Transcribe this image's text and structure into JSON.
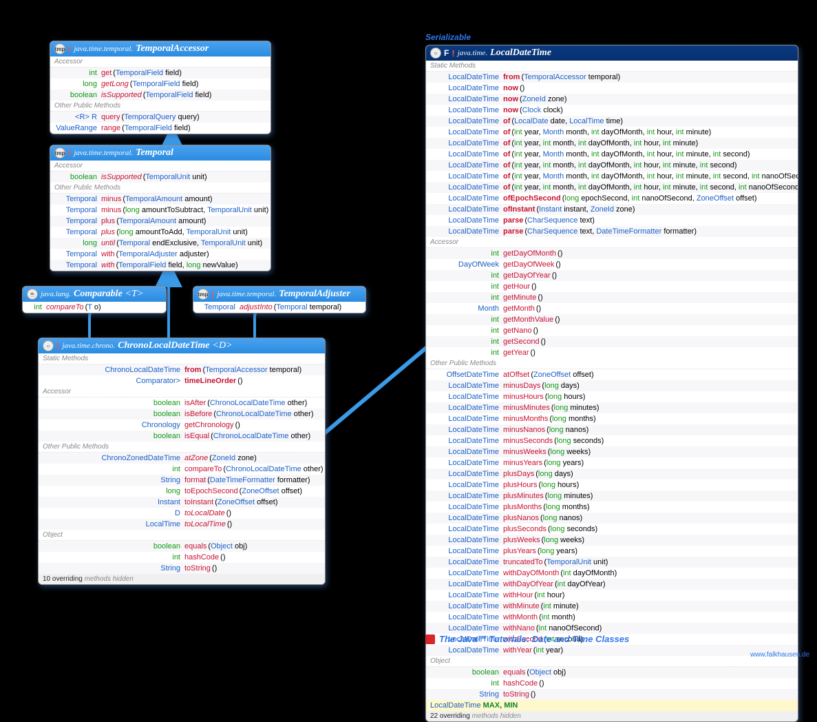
{
  "serializable": "Serializable",
  "tutorial": "The Java™ Tutorials: Date and Time Classes",
  "credit": "www.falkhausen.de",
  "boxes": {
    "ta": {
      "pkg": "java.time.temporal.",
      "name": "TemporalAccessor",
      "iconTxt": "tmp",
      "bang": true,
      "sections": [
        {
          "title": "Accessor",
          "rows": [
            {
              "ret": "int",
              "m": "get",
              "sig": "(TemporalField field)"
            },
            {
              "ret": "long",
              "m": "getLong",
              "sig": "(TemporalField field)",
              "mi": true
            },
            {
              "ret": "boolean",
              "m": "isSupported",
              "sig": "(TemporalField field)",
              "mi": true
            }
          ]
        },
        {
          "title": "Other Public Methods",
          "rows": [
            {
              "ret": "<R> R",
              "m": "query",
              "sig": "(TemporalQuery<R> query)"
            },
            {
              "ret": "ValueRange",
              "m": "range",
              "sig": "(TemporalField field)"
            }
          ]
        }
      ]
    },
    "tp": {
      "pkg": "java.time.temporal.",
      "name": "Temporal",
      "iconTxt": "tmp",
      "bang": true,
      "sections": [
        {
          "title": "Accessor",
          "rows": [
            {
              "ret": "boolean",
              "m": "isSupported",
              "sig": "(TemporalUnit unit)",
              "mi": true
            }
          ]
        },
        {
          "title": "Other Public Methods",
          "rows": [
            {
              "ret": "Temporal",
              "m": "minus",
              "sig": "(TemporalAmount amount)"
            },
            {
              "ret": "Temporal",
              "m": "minus",
              "sig": "(long amountToSubtract, TemporalUnit unit)"
            },
            {
              "ret": "Temporal",
              "m": "plus",
              "sig": "(TemporalAmount amount)"
            },
            {
              "ret": "Temporal",
              "m": "plus",
              "sig": "(long amountToAdd, TemporalUnit unit)",
              "mi": true
            },
            {
              "ret": "long",
              "m": "until",
              "sig": "(Temporal endExclusive, TemporalUnit unit)",
              "mi": true
            },
            {
              "ret": "Temporal",
              "m": "with",
              "sig": "(TemporalAdjuster adjuster)"
            },
            {
              "ret": "Temporal",
              "m": "with",
              "sig": "(TemporalField field, long newValue)",
              "mi": true
            }
          ]
        }
      ]
    },
    "cmp": {
      "pkg": "java.lang.",
      "name": "Comparable",
      "typeParam": "<T>",
      "iconTxt": "☕",
      "bang": false,
      "sections": [
        {
          "title": "",
          "rows": [
            {
              "ret": "int",
              "m": "compareTo",
              "sig": "(T o)",
              "mi": true
            }
          ]
        }
      ]
    },
    "adj": {
      "pkg": "java.time.temporal.",
      "name": "TemporalAdjuster",
      "iconTxt": "tmp",
      "bang": true,
      "sections": [
        {
          "title": "",
          "rows": [
            {
              "ret": "Temporal",
              "m": "adjustInto",
              "sig": "(Temporal temporal)",
              "mi": true
            }
          ]
        }
      ]
    },
    "cldt": {
      "pkg": "java.time.chrono.",
      "name": "ChronoLocalDateTime",
      "typeParam": "<D>",
      "iconTxt": "○",
      "bang": true,
      "sections": [
        {
          "title": "Static Methods",
          "rows": [
            {
              "ret": "ChronoLocalDateTime<?>",
              "m": "from",
              "sig": "(TemporalAccessor temporal)",
              "mb": true
            },
            {
              "ret": "Comparator<ChronoLocalDateTime<?>>",
              "m": "timeLineOrder",
              "sig": "()",
              "mb": true
            }
          ]
        },
        {
          "title": "Accessor",
          "rows": [
            {
              "ret": "boolean",
              "m": "isAfter",
              "sig": "(ChronoLocalDateTime<?> other)"
            },
            {
              "ret": "boolean",
              "m": "isBefore",
              "sig": "(ChronoLocalDateTime<?> other)"
            },
            {
              "ret": "Chronology",
              "m": "getChronology",
              "sig": "()"
            },
            {
              "ret": "boolean",
              "m": "isEqual",
              "sig": "(ChronoLocalDateTime<?> other)"
            }
          ]
        },
        {
          "title": "Other Public Methods",
          "rows": [
            {
              "ret": "ChronoZonedDateTime<D>",
              "m": "atZone",
              "sig": "(ZoneId zone)",
              "mi": true
            },
            {
              "ret": "int",
              "m": "compareTo",
              "sig": "(ChronoLocalDateTime<?> other)"
            },
            {
              "ret": "String",
              "m": "format",
              "sig": "(DateTimeFormatter formatter)"
            },
            {
              "ret": "long",
              "m": "toEpochSecond",
              "sig": "(ZoneOffset offset)"
            },
            {
              "ret": "Instant",
              "m": "toInstant",
              "sig": "(ZoneOffset offset)"
            },
            {
              "ret": "D",
              "m": "toLocalDate",
              "sig": "()",
              "mi": true
            },
            {
              "ret": "LocalTime",
              "m": "toLocalTime",
              "sig": "()",
              "mi": true
            }
          ]
        },
        {
          "title": "Object",
          "rows": [
            {
              "ret": "boolean",
              "m": "equals",
              "sig": "(Object obj)"
            },
            {
              "ret": "int",
              "m": "hashCode",
              "sig": "()"
            },
            {
              "ret": "String",
              "m": "toString",
              "sig": "()"
            }
          ]
        }
      ],
      "hidden": "10 overriding"
    },
    "ldt": {
      "pkg": "java.time.",
      "name": "LocalDateTime",
      "iconTxt": "○",
      "bang": true,
      "finalBar": true,
      "sections": [
        {
          "title": "Static Methods",
          "rows": [
            {
              "ret": "LocalDateTime",
              "m": "from",
              "sig": "(TemporalAccessor temporal)",
              "mb": true
            },
            {
              "ret": "LocalDateTime",
              "m": "now",
              "sig": "()",
              "mb": true
            },
            {
              "ret": "LocalDateTime",
              "m": "now",
              "sig": "(ZoneId zone)",
              "mb": true
            },
            {
              "ret": "LocalDateTime",
              "m": "now",
              "sig": "(Clock clock)",
              "mb": true
            },
            {
              "ret": "LocalDateTime",
              "m": "of",
              "sig": "(LocalDate date, LocalTime time)",
              "mb": true
            },
            {
              "ret": "LocalDateTime",
              "m": "of",
              "sig": "(int year, Month month, int dayOfMonth, int hour, int minute)",
              "mb": true
            },
            {
              "ret": "LocalDateTime",
              "m": "of",
              "sig": "(int year, int month, int dayOfMonth, int hour, int minute)",
              "mb": true
            },
            {
              "ret": "LocalDateTime",
              "m": "of",
              "sig": "(int year, Month month, int dayOfMonth, int hour, int minute, int second)",
              "mb": true
            },
            {
              "ret": "LocalDateTime",
              "m": "of",
              "sig": "(int year, int month, int dayOfMonth, int hour, int minute, int second)",
              "mb": true
            },
            {
              "ret": "LocalDateTime",
              "m": "of",
              "sig": "(int year, Month month, int dayOfMonth, int hour, int minute, int second, int nanoOfSecond)",
              "mb": true
            },
            {
              "ret": "LocalDateTime",
              "m": "of",
              "sig": "(int year, int month, int dayOfMonth, int hour, int minute, int second, int nanoOfSecond)",
              "mb": true
            },
            {
              "ret": "LocalDateTime",
              "m": "ofEpochSecond",
              "sig": "(long epochSecond, int nanoOfSecond, ZoneOffset offset)",
              "mb": true
            },
            {
              "ret": "LocalDateTime",
              "m": "ofInstant",
              "sig": "(Instant instant, ZoneId zone)",
              "mb": true
            },
            {
              "ret": "LocalDateTime",
              "m": "parse",
              "sig": "(CharSequence text)",
              "mb": true
            },
            {
              "ret": "LocalDateTime",
              "m": "parse",
              "sig": "(CharSequence text, DateTimeFormatter formatter)",
              "mb": true
            }
          ]
        },
        {
          "title": "Accessor",
          "rows": [
            {
              "ret": "int",
              "m": "getDayOfMonth",
              "sig": "()"
            },
            {
              "ret": "DayOfWeek",
              "m": "getDayOfWeek",
              "sig": "()"
            },
            {
              "ret": "int",
              "m": "getDayOfYear",
              "sig": "()"
            },
            {
              "ret": "int",
              "m": "getHour",
              "sig": "()"
            },
            {
              "ret": "int",
              "m": "getMinute",
              "sig": "()"
            },
            {
              "ret": "Month",
              "m": "getMonth",
              "sig": "()"
            },
            {
              "ret": "int",
              "m": "getMonthValue",
              "sig": "()"
            },
            {
              "ret": "int",
              "m": "getNano",
              "sig": "()"
            },
            {
              "ret": "int",
              "m": "getSecond",
              "sig": "()"
            },
            {
              "ret": "int",
              "m": "getYear",
              "sig": "()"
            }
          ]
        },
        {
          "title": "Other Public Methods",
          "rows": [
            {
              "ret": "OffsetDateTime",
              "m": "atOffset",
              "sig": "(ZoneOffset offset)"
            },
            {
              "ret": "LocalDateTime",
              "m": "minusDays",
              "sig": "(long days)"
            },
            {
              "ret": "LocalDateTime",
              "m": "minusHours",
              "sig": "(long hours)"
            },
            {
              "ret": "LocalDateTime",
              "m": "minusMinutes",
              "sig": "(long minutes)"
            },
            {
              "ret": "LocalDateTime",
              "m": "minusMonths",
              "sig": "(long months)"
            },
            {
              "ret": "LocalDateTime",
              "m": "minusNanos",
              "sig": "(long nanos)"
            },
            {
              "ret": "LocalDateTime",
              "m": "minusSeconds",
              "sig": "(long seconds)"
            },
            {
              "ret": "LocalDateTime",
              "m": "minusWeeks",
              "sig": "(long weeks)"
            },
            {
              "ret": "LocalDateTime",
              "m": "minusYears",
              "sig": "(long years)"
            },
            {
              "ret": "LocalDateTime",
              "m": "plusDays",
              "sig": "(long days)"
            },
            {
              "ret": "LocalDateTime",
              "m": "plusHours",
              "sig": "(long hours)"
            },
            {
              "ret": "LocalDateTime",
              "m": "plusMinutes",
              "sig": "(long minutes)"
            },
            {
              "ret": "LocalDateTime",
              "m": "plusMonths",
              "sig": "(long months)"
            },
            {
              "ret": "LocalDateTime",
              "m": "plusNanos",
              "sig": "(long nanos)"
            },
            {
              "ret": "LocalDateTime",
              "m": "plusSeconds",
              "sig": "(long seconds)"
            },
            {
              "ret": "LocalDateTime",
              "m": "plusWeeks",
              "sig": "(long weeks)"
            },
            {
              "ret": "LocalDateTime",
              "m": "plusYears",
              "sig": "(long years)"
            },
            {
              "ret": "LocalDateTime",
              "m": "truncatedTo",
              "sig": "(TemporalUnit unit)"
            },
            {
              "ret": "LocalDateTime",
              "m": "withDayOfMonth",
              "sig": "(int dayOfMonth)"
            },
            {
              "ret": "LocalDateTime",
              "m": "withDayOfYear",
              "sig": "(int dayOfYear)"
            },
            {
              "ret": "LocalDateTime",
              "m": "withHour",
              "sig": "(int hour)"
            },
            {
              "ret": "LocalDateTime",
              "m": "withMinute",
              "sig": "(int minute)"
            },
            {
              "ret": "LocalDateTime",
              "m": "withMonth",
              "sig": "(int month)"
            },
            {
              "ret": "LocalDateTime",
              "m": "withNano",
              "sig": "(int nanoOfSecond)"
            },
            {
              "ret": "LocalDateTime",
              "m": "withSecond",
              "sig": "(int second)"
            },
            {
              "ret": "LocalDateTime",
              "m": "withYear",
              "sig": "(int year)"
            }
          ]
        },
        {
          "title": "Object",
          "rows": [
            {
              "ret": "boolean",
              "m": "equals",
              "sig": "(Object obj)"
            },
            {
              "ret": "int",
              "m": "hashCode",
              "sig": "()"
            },
            {
              "ret": "String",
              "m": "toString",
              "sig": "()"
            }
          ]
        }
      ],
      "fields": {
        "ret": "LocalDateTime",
        "names": "MAX, MIN"
      },
      "hidden": "22 overriding"
    }
  },
  "hiddenSuffix": " methods hidden"
}
